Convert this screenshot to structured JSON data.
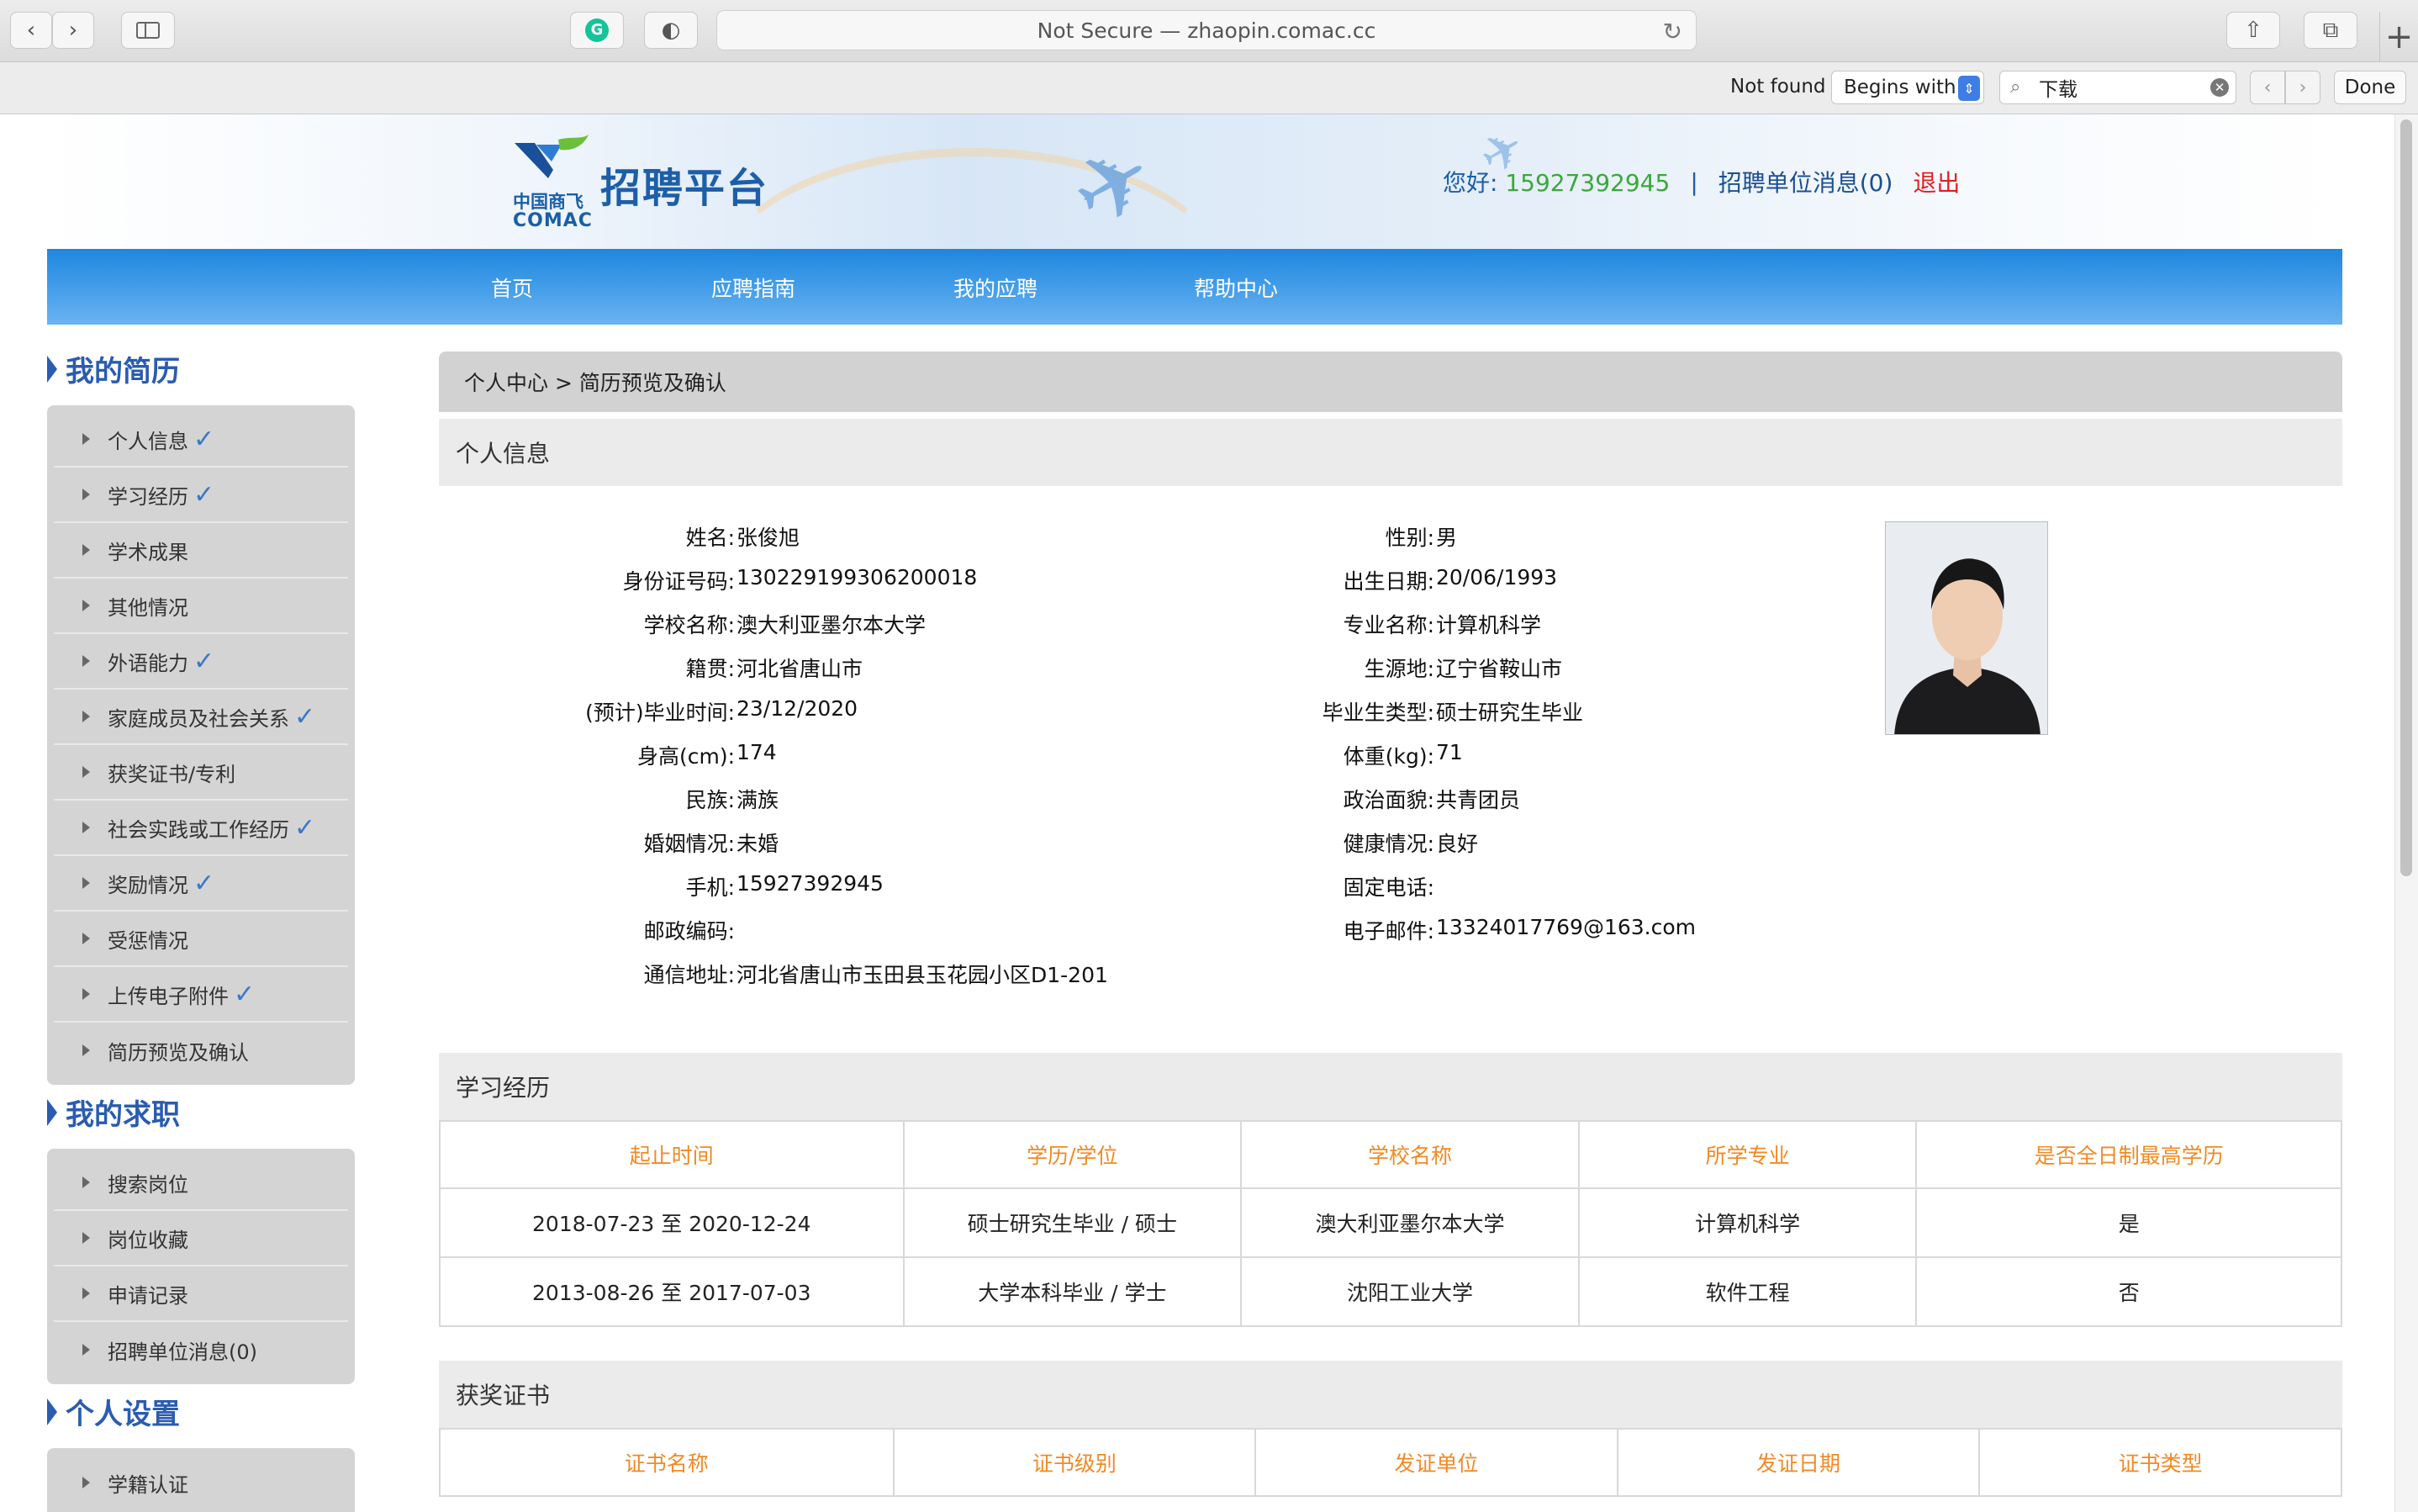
{
  "browser": {
    "address": "Not Secure — zhaopin.comac.cc",
    "find_status": "Not found",
    "find_mode": "Begins with",
    "find_query": "下载",
    "find_done": "Done"
  },
  "header": {
    "logo_cn": "中国商飞",
    "logo_en": "COMAC",
    "logo_title": "招聘平台",
    "greeting": "您好:",
    "phone": "15927392945",
    "separator": "|",
    "messages": "招聘单位消息(0)",
    "logout": "退出"
  },
  "nav": [
    "首页",
    "应聘指南",
    "我的应聘",
    "帮助中心"
  ],
  "sidebar": {
    "resume_title": "我的简历",
    "resume_items": [
      {
        "label": "个人信息",
        "done": true
      },
      {
        "label": "学习经历",
        "done": true
      },
      {
        "label": "学术成果",
        "done": false
      },
      {
        "label": "其他情况",
        "done": false
      },
      {
        "label": "外语能力",
        "done": true
      },
      {
        "label": "家庭成员及社会关系",
        "done": true
      },
      {
        "label": "获奖证书/专利",
        "done": false
      },
      {
        "label": "社会实践或工作经历",
        "done": true
      },
      {
        "label": "奖励情况",
        "done": true
      },
      {
        "label": "受惩情况",
        "done": false
      },
      {
        "label": "上传电子附件",
        "done": true
      },
      {
        "label": "简历预览及确认",
        "done": false
      }
    ],
    "job_title": "我的求职",
    "job_items": [
      "搜索岗位",
      "岗位收藏",
      "申请记录",
      "招聘单位消息(0)"
    ],
    "settings_title": "个人设置",
    "settings_items": [
      "学籍认证"
    ]
  },
  "breadcrumb": "个人中心 > 简历预览及确认",
  "personal": {
    "section_title": "个人信息",
    "left": [
      {
        "label": "姓名:",
        "value": "张俊旭"
      },
      {
        "label": "身份证号码:",
        "value": "130229199306200018"
      },
      {
        "label": "学校名称:",
        "value": "澳大利亚墨尔本大学"
      },
      {
        "label": "籍贯:",
        "value": "河北省唐山市"
      },
      {
        "label": "(预计)毕业时间:",
        "value": "23/12/2020"
      },
      {
        "label": "身高(cm):",
        "value": "174"
      },
      {
        "label": "民族:",
        "value": "满族"
      },
      {
        "label": "婚姻情况:",
        "value": "未婚"
      },
      {
        "label": "手机:",
        "value": "15927392945"
      },
      {
        "label": "邮政编码:",
        "value": ""
      },
      {
        "label": "通信地址:",
        "value": "河北省唐山市玉田县玉花园小区D1-201"
      }
    ],
    "right": [
      {
        "label": "性别:",
        "value": "男"
      },
      {
        "label": "出生日期:",
        "value": "20/06/1993"
      },
      {
        "label": "专业名称:",
        "value": "计算机科学"
      },
      {
        "label": "生源地:",
        "value": "辽宁省鞍山市"
      },
      {
        "label": "毕业生类型:",
        "value": "硕士研究生毕业"
      },
      {
        "label": "体重(kg):",
        "value": "71"
      },
      {
        "label": "政治面貌:",
        "value": "共青团员"
      },
      {
        "label": "健康情况:",
        "value": "良好"
      },
      {
        "label": "固定电话:",
        "value": ""
      },
      {
        "label": "电子邮件:",
        "value": "13324017769@163.com"
      }
    ]
  },
  "education": {
    "section_title": "学习经历",
    "headers": [
      "起止时间",
      "学历/学位",
      "学校名称",
      "所学专业",
      "是否全日制最高学历"
    ],
    "rows": [
      [
        "2018-07-23 至 2020-12-24",
        "硕士研究生毕业 / 硕士",
        "澳大利亚墨尔本大学",
        "计算机科学",
        "是"
      ],
      [
        "2013-08-26 至 2017-07-03",
        "大学本科毕业 / 学士",
        "沈阳工业大学",
        "软件工程",
        "否"
      ]
    ]
  },
  "awards": {
    "section_title": "获奖证书",
    "headers": [
      "证书名称",
      "证书级别",
      "发证单位",
      "发证日期",
      "证书类型"
    ]
  },
  "colors": {
    "nav_blue": "#3f9be8",
    "title_blue": "#2a5cb0",
    "header_orange": "#f08a24",
    "logout_red": "#e02020",
    "phone_green": "#3aa83a"
  }
}
